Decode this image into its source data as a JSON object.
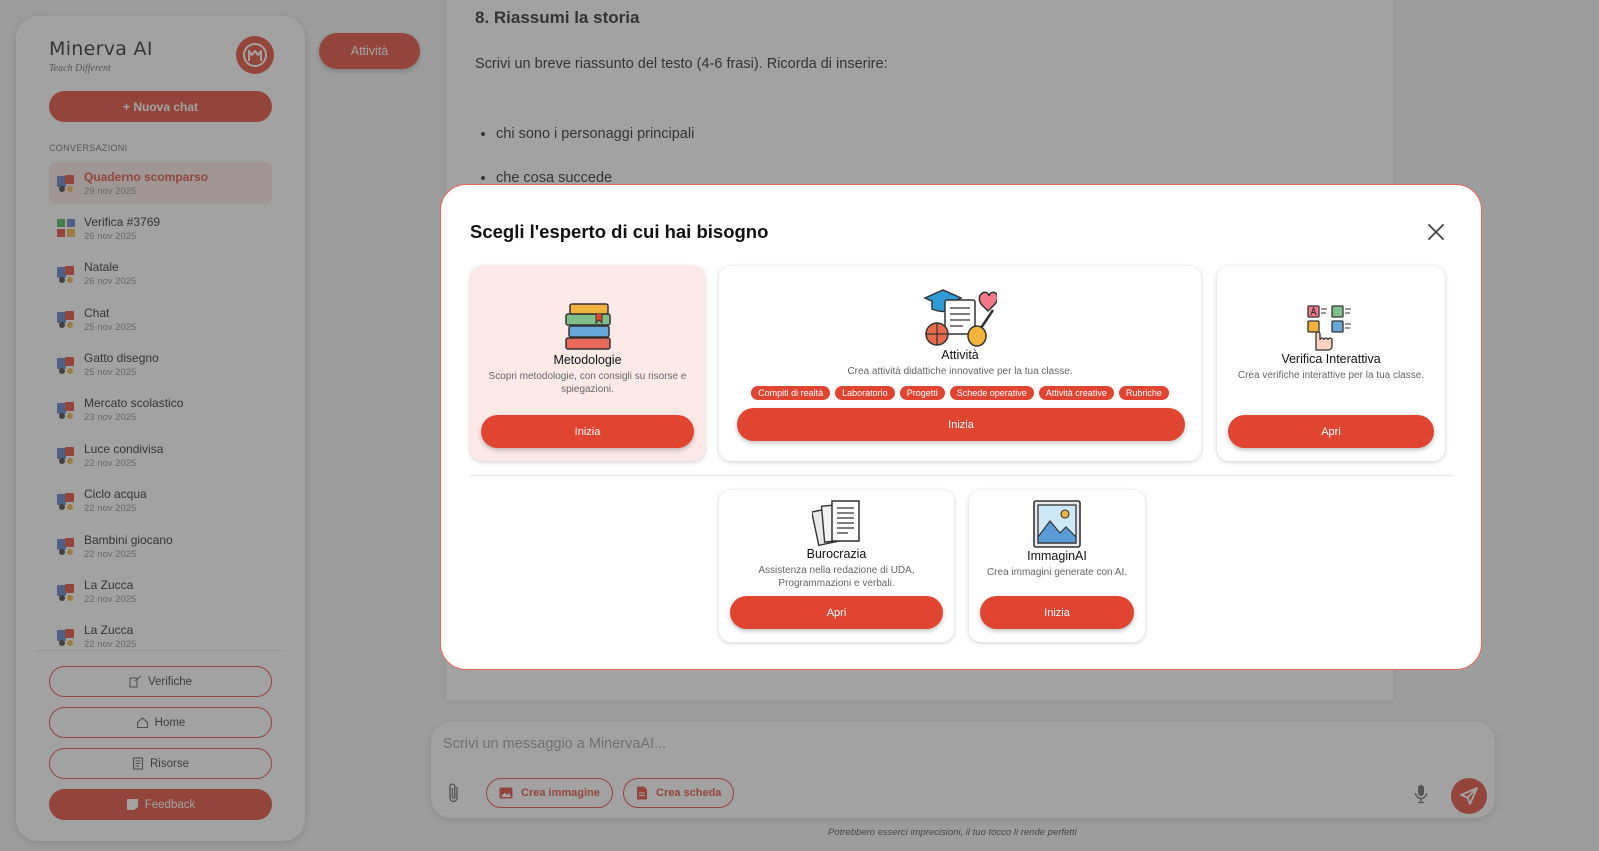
{
  "brand": {
    "name": "Minerva AI",
    "tagline": "Teach Different"
  },
  "sidebar": {
    "new_chat": "+ Nuova chat",
    "section_label": "CONVERSAZIONI",
    "conversations": [
      {
        "title": "Quaderno scomparso",
        "date": "29 nov 2025"
      },
      {
        "title": "Verifica #3769",
        "date": "26 nov 2025"
      },
      {
        "title": "Natale",
        "date": "26 nov 2025"
      },
      {
        "title": "Chat",
        "date": "25 nov 2025"
      },
      {
        "title": "Gatto disegno",
        "date": "25 nov 2025"
      },
      {
        "title": "Mercato scolastico",
        "date": "23 nov 2025"
      },
      {
        "title": "Luce condivisa",
        "date": "22 nov 2025"
      },
      {
        "title": "Ciclo acqua",
        "date": "22 nov 2025"
      },
      {
        "title": "Bambini giocano",
        "date": "22 nov 2025"
      },
      {
        "title": "La Zucca",
        "date": "22 nov 2025"
      },
      {
        "title": "La Zucca",
        "date": "22 nov 2025"
      }
    ],
    "buttons": {
      "verifiche": "Verifiche",
      "home": "Home",
      "risorse": "Risorse",
      "feedback": "Feedback"
    }
  },
  "main": {
    "mode_chip": "Attività",
    "heading": "8. Riassumi la storia",
    "intro": "Scrivi un breve riassunto del testo (4-6 frasi). Ricorda di inserire:",
    "bullets": [
      "chi sono i personaggi principali",
      "che cosa succede"
    ]
  },
  "composer": {
    "placeholder": "Scrivi un messaggio a MinervaAI...",
    "create_image": "Crea immagine",
    "create_sheet": "Crea scheda",
    "disclaimer": "Potrebbero esserci imprecisioni, il tuo tocco li rende perfetti"
  },
  "modal": {
    "title": "Scegli l'esperto di cui hai bisogno",
    "cards": {
      "metodologie": {
        "title": "Metodologie",
        "desc": "Scopri metodologie, con consigli su risorse e spiegazioni.",
        "button": "Inizia"
      },
      "attivita": {
        "title": "Attività",
        "desc": "Crea attività didattiche innovative per la tua classe.",
        "tags": [
          "Compiti di realtà",
          "Laboratorio",
          "Progetti",
          "Schede operative",
          "Attività creative",
          "Rubriche"
        ],
        "button": "Inizia"
      },
      "verifica": {
        "title": "Verifica Interattiva",
        "desc": "Crea verifiche interattive per la tua classe.",
        "button": "Apri"
      },
      "burocrazia": {
        "title": "Burocrazia",
        "desc": "Assistenza nella redazione di UDA, Programmazioni e verbali.",
        "button": "Apri"
      },
      "immaginai": {
        "title": "ImmaginAI",
        "desc": "Crea immagini generate con AI.",
        "button": "Inizia"
      }
    }
  },
  "colors": {
    "accent": "#e04532",
    "active_bg": "#fbe7e4"
  }
}
